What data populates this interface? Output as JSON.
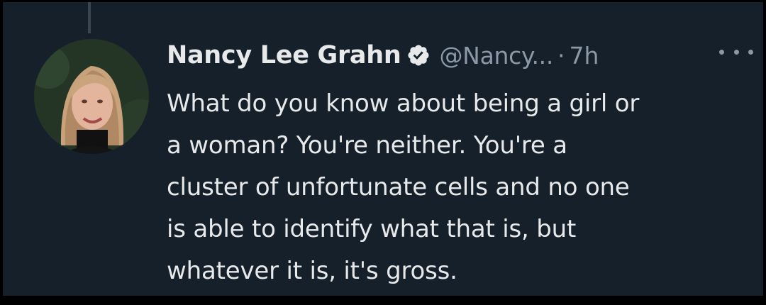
{
  "tweet": {
    "author": {
      "display_name": "Nancy Lee Grahn",
      "handle": "@Nancy...",
      "verified": true,
      "avatar_icon": "profile-photo"
    },
    "separator": "·",
    "time": "7h",
    "more_icon": "more-horizontal-icon",
    "text_lines": [
      "What do you know about being a girl or",
      "a woman?  You're neither. You're a",
      "cluster of unfortunate cells and no one",
      "is able to identify what that is, but",
      "whatever it is, it's gross."
    ]
  },
  "colors": {
    "background": "#15202b",
    "text_primary": "#e7e9ea",
    "text_secondary": "#8b98a5"
  }
}
